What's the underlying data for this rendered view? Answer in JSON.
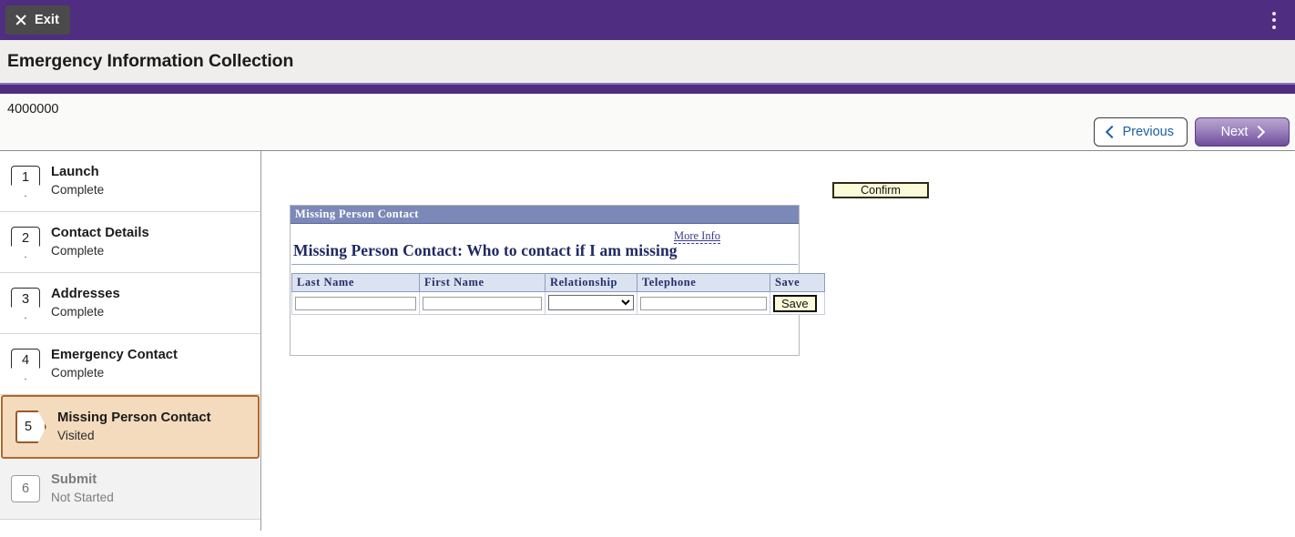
{
  "topbar": {
    "exit_label": "Exit",
    "exit_icon": "close-icon",
    "menu_icon": "kebab-menu-icon",
    "bg_color": "#4f2d80"
  },
  "header": {
    "title": "Emergency Information Collection",
    "record_id": "4000000"
  },
  "nav": {
    "previous_label": "Previous",
    "next_label": "Next"
  },
  "sidebar": {
    "steps": [
      {
        "number": "1",
        "title": "Launch",
        "status": "Complete"
      },
      {
        "number": "2",
        "title": "Contact Details",
        "status": "Complete"
      },
      {
        "number": "3",
        "title": "Addresses",
        "status": "Complete"
      },
      {
        "number": "4",
        "title": "Emergency Contact",
        "status": "Complete"
      },
      {
        "number": "5",
        "title": "Missing Person Contact",
        "status": "Visited"
      },
      {
        "number": "6",
        "title": "Submit",
        "status": "Not Started"
      }
    ]
  },
  "content": {
    "confirm_label": "Confirm",
    "panel": {
      "header": "Missing Person Contact",
      "more_info": "More Info",
      "title": "Missing Person Contact: Who to contact if I am missing",
      "columns": [
        "Last Name",
        "First Name",
        "Relationship",
        "Telephone",
        "Save"
      ],
      "row": {
        "last_name": "",
        "first_name": "",
        "relationship": "",
        "telephone": "",
        "save_label": "Save"
      }
    }
  },
  "colors": {
    "brand_purple": "#4f2d80",
    "panel_header_blue": "#7b88b8",
    "grid_header_blue": "#dbe3f1",
    "active_step_bg": "#f4dbbd",
    "active_step_border": "#b1692c",
    "button_yellow": "#fbfbd9",
    "link_blue": "#1c5fa8"
  }
}
